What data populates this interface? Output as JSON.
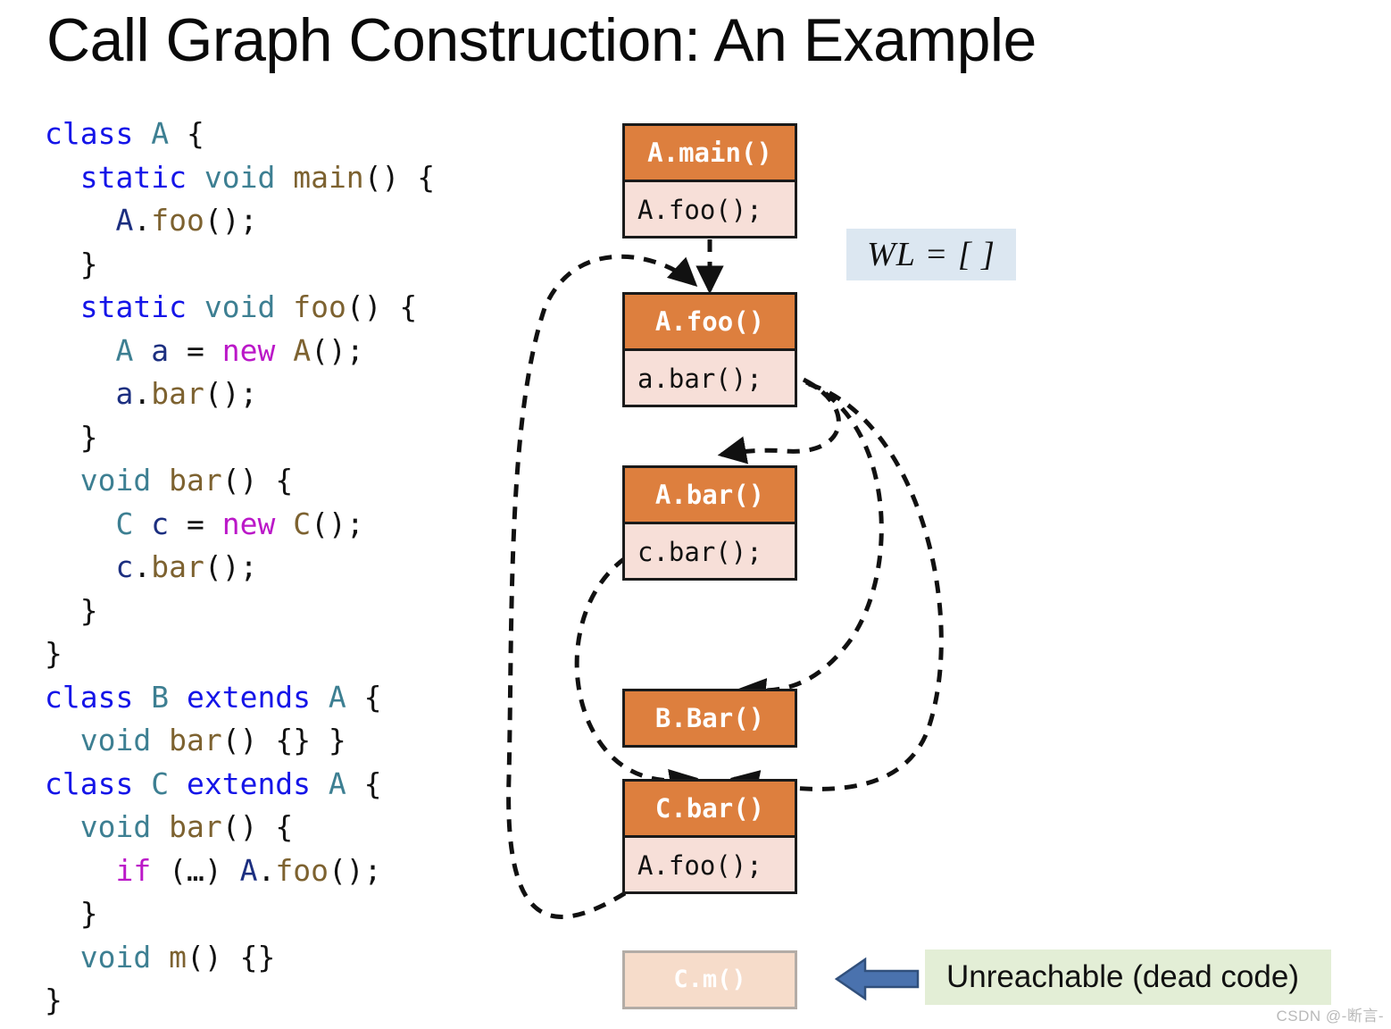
{
  "title": "Call Graph Construction: An Example",
  "code": {
    "lines": [
      [
        {
          "t": "class",
          "c": "kw"
        },
        {
          "t": " ",
          "c": "pl"
        },
        {
          "t": "A",
          "c": "ty"
        },
        {
          "t": " {",
          "c": "pl"
        }
      ],
      [
        {
          "t": "  ",
          "c": "pl"
        },
        {
          "t": "static",
          "c": "kw"
        },
        {
          "t": " ",
          "c": "pl"
        },
        {
          "t": "void",
          "c": "ty"
        },
        {
          "t": " ",
          "c": "pl"
        },
        {
          "t": "main",
          "c": "fn"
        },
        {
          "t": "() {",
          "c": "pl"
        }
      ],
      [
        {
          "t": "    ",
          "c": "pl"
        },
        {
          "t": "A",
          "c": "va"
        },
        {
          "t": ".",
          "c": "pl"
        },
        {
          "t": "foo",
          "c": "fn"
        },
        {
          "t": "();",
          "c": "pl"
        }
      ],
      [
        {
          "t": "  }",
          "c": "pl"
        }
      ],
      [
        {
          "t": "  ",
          "c": "pl"
        },
        {
          "t": "static",
          "c": "kw"
        },
        {
          "t": " ",
          "c": "pl"
        },
        {
          "t": "void",
          "c": "ty"
        },
        {
          "t": " ",
          "c": "pl"
        },
        {
          "t": "foo",
          "c": "fn"
        },
        {
          "t": "() {",
          "c": "pl"
        }
      ],
      [
        {
          "t": "    ",
          "c": "pl"
        },
        {
          "t": "A",
          "c": "ty"
        },
        {
          "t": " ",
          "c": "pl"
        },
        {
          "t": "a",
          "c": "va"
        },
        {
          "t": " = ",
          "c": "pl"
        },
        {
          "t": "new",
          "c": "nw"
        },
        {
          "t": " ",
          "c": "pl"
        },
        {
          "t": "A",
          "c": "fn"
        },
        {
          "t": "();",
          "c": "pl"
        }
      ],
      [
        {
          "t": "    ",
          "c": "pl"
        },
        {
          "t": "a",
          "c": "va"
        },
        {
          "t": ".",
          "c": "pl"
        },
        {
          "t": "bar",
          "c": "fn"
        },
        {
          "t": "();",
          "c": "pl"
        }
      ],
      [
        {
          "t": "  }",
          "c": "pl"
        }
      ],
      [
        {
          "t": "  ",
          "c": "pl"
        },
        {
          "t": "void",
          "c": "ty"
        },
        {
          "t": " ",
          "c": "pl"
        },
        {
          "t": "bar",
          "c": "fn"
        },
        {
          "t": "() {",
          "c": "pl"
        }
      ],
      [
        {
          "t": "    ",
          "c": "pl"
        },
        {
          "t": "C",
          "c": "ty"
        },
        {
          "t": " ",
          "c": "pl"
        },
        {
          "t": "c",
          "c": "va"
        },
        {
          "t": " = ",
          "c": "pl"
        },
        {
          "t": "new",
          "c": "nw"
        },
        {
          "t": " ",
          "c": "pl"
        },
        {
          "t": "C",
          "c": "fn"
        },
        {
          "t": "();",
          "c": "pl"
        }
      ],
      [
        {
          "t": "    ",
          "c": "pl"
        },
        {
          "t": "c",
          "c": "va"
        },
        {
          "t": ".",
          "c": "pl"
        },
        {
          "t": "bar",
          "c": "fn"
        },
        {
          "t": "();",
          "c": "pl"
        }
      ],
      [
        {
          "t": "  }",
          "c": "pl"
        }
      ],
      [
        {
          "t": "}",
          "c": "pl"
        }
      ],
      [
        {
          "t": "class",
          "c": "kw"
        },
        {
          "t": " ",
          "c": "pl"
        },
        {
          "t": "B",
          "c": "ty"
        },
        {
          "t": " ",
          "c": "pl"
        },
        {
          "t": "extends",
          "c": "kw"
        },
        {
          "t": " ",
          "c": "pl"
        },
        {
          "t": "A",
          "c": "ty"
        },
        {
          "t": " {",
          "c": "pl"
        }
      ],
      [
        {
          "t": "  ",
          "c": "pl"
        },
        {
          "t": "void",
          "c": "ty"
        },
        {
          "t": " ",
          "c": "pl"
        },
        {
          "t": "bar",
          "c": "fn"
        },
        {
          "t": "() {} }",
          "c": "pl"
        }
      ],
      [
        {
          "t": "class",
          "c": "kw"
        },
        {
          "t": " ",
          "c": "pl"
        },
        {
          "t": "C",
          "c": "ty"
        },
        {
          "t": " ",
          "c": "pl"
        },
        {
          "t": "extends",
          "c": "kw"
        },
        {
          "t": " ",
          "c": "pl"
        },
        {
          "t": "A",
          "c": "ty"
        },
        {
          "t": " {",
          "c": "pl"
        }
      ],
      [
        {
          "t": "  ",
          "c": "pl"
        },
        {
          "t": "void",
          "c": "ty"
        },
        {
          "t": " ",
          "c": "pl"
        },
        {
          "t": "bar",
          "c": "fn"
        },
        {
          "t": "() {",
          "c": "pl"
        }
      ],
      [
        {
          "t": "    ",
          "c": "pl"
        },
        {
          "t": "if",
          "c": "nw"
        },
        {
          "t": " (…) ",
          "c": "pl"
        },
        {
          "t": "A",
          "c": "va"
        },
        {
          "t": ".",
          "c": "pl"
        },
        {
          "t": "foo",
          "c": "fn"
        },
        {
          "t": "();",
          "c": "pl"
        }
      ],
      [
        {
          "t": "  }",
          "c": "pl"
        }
      ],
      [
        {
          "t": "  ",
          "c": "pl"
        },
        {
          "t": "void",
          "c": "ty"
        },
        {
          "t": " ",
          "c": "pl"
        },
        {
          "t": "m",
          "c": "fn"
        },
        {
          "t": "() {}",
          "c": "pl"
        }
      ],
      [
        {
          "t": "}",
          "c": "pl"
        }
      ]
    ]
  },
  "graph": {
    "nodes": [
      {
        "id": "a-main",
        "header": "A.main()",
        "body": "A.foo();",
        "dead": false
      },
      {
        "id": "a-foo",
        "header": "A.foo()",
        "body": "a.bar();",
        "dead": false
      },
      {
        "id": "a-bar",
        "header": "A.bar()",
        "body": "c.bar();",
        "dead": false
      },
      {
        "id": "b-bar",
        "header": "B.Bar()",
        "body": null,
        "dead": false
      },
      {
        "id": "c-bar",
        "header": "C.bar()",
        "body": "A.foo();",
        "dead": false
      },
      {
        "id": "c-m",
        "header": "C.m()",
        "body": null,
        "dead": true
      }
    ],
    "edges": [
      {
        "from": "a-main",
        "to": "a-foo"
      },
      {
        "from": "a-foo",
        "to": "a-bar"
      },
      {
        "from": "a-foo",
        "to": "b-bar"
      },
      {
        "from": "a-foo",
        "to": "c-bar"
      },
      {
        "from": "a-bar",
        "to": "c-bar"
      },
      {
        "from": "c-bar",
        "to": "a-foo"
      }
    ]
  },
  "worklist": {
    "label": "WL = [  ]"
  },
  "legend": {
    "text": "Unreachable (dead code)",
    "arrow_icon": "left-arrow-icon"
  },
  "colors": {
    "node_header": "#DD7F3E",
    "node_body": "#F7DFD8",
    "wl_background": "#DCE7F1",
    "legend_background": "#E3EED6",
    "legend_arrow": "#4472A8",
    "dead_node": "#F6DCCA"
  },
  "watermark": "CSDN @-断言-"
}
